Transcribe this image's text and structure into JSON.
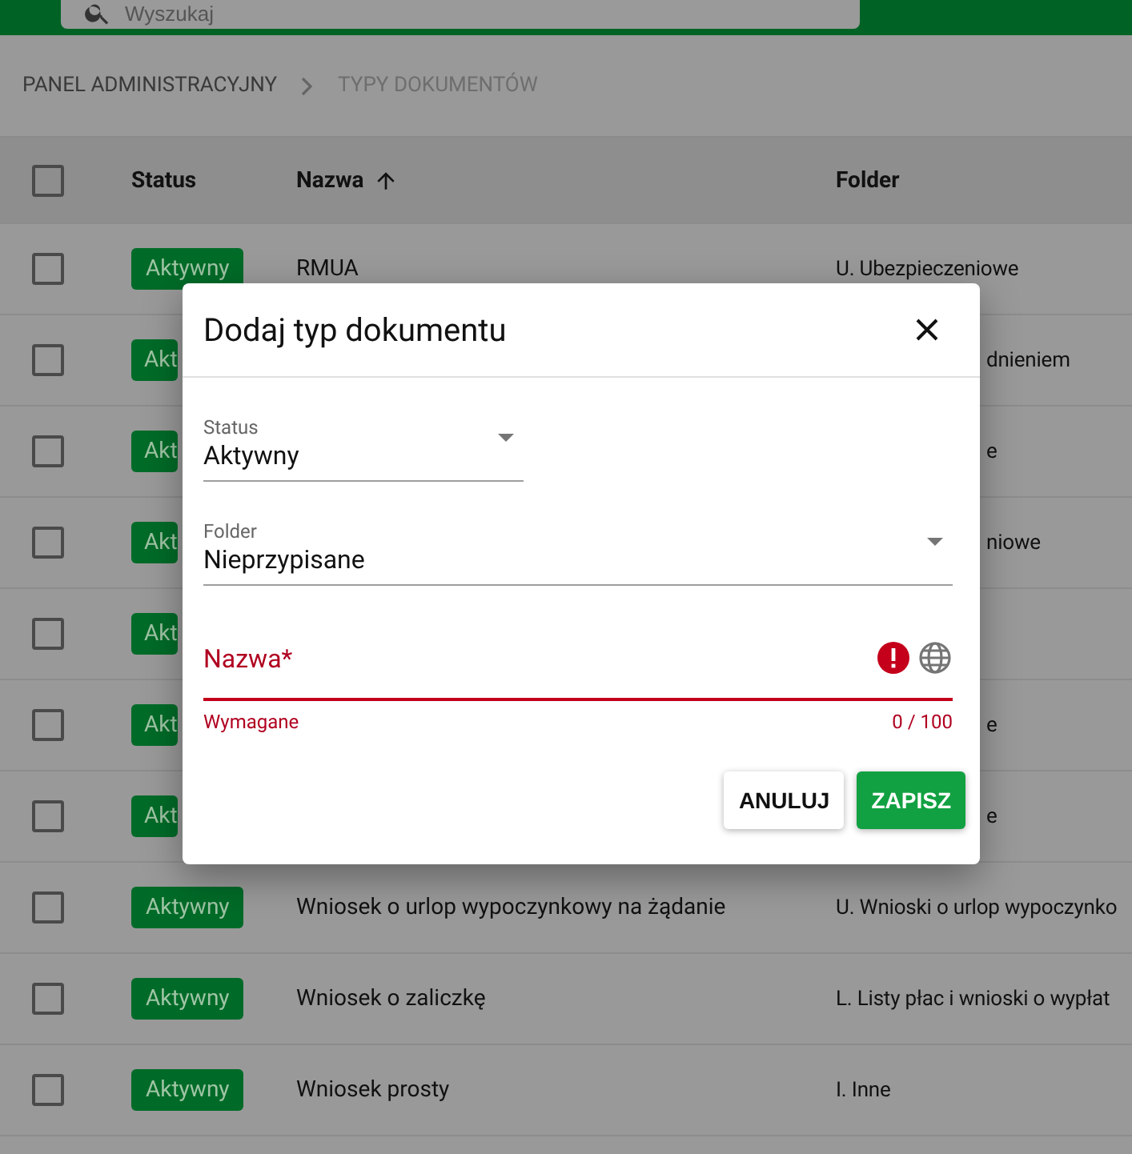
{
  "header": {
    "search": {
      "placeholder": "Wyszukaj"
    }
  },
  "breadcrumb": [
    {
      "label": "PANEL ADMINISTRACYJNY",
      "current": false
    },
    {
      "label": "TYPY DOKUMENTÓW",
      "current": true
    }
  ],
  "table": {
    "select_all": {
      "checked": false
    },
    "columns": [
      {
        "label": "Status"
      },
      {
        "label": "Nazwa",
        "sorted_ascending": true
      },
      {
        "label": "Folder"
      }
    ],
    "rows": [
      {
        "kind": "full",
        "checked": false,
        "status": "Aktywny",
        "name": "RMUA",
        "folder": "U. Ubezpieczeniowe"
      },
      {
        "kind": "partial",
        "checked": false,
        "status": "Akt",
        "folder": "dnieniem"
      },
      {
        "kind": "partial",
        "checked": false,
        "status": "Akt",
        "folder": "e"
      },
      {
        "kind": "partial",
        "checked": false,
        "status": "Akt",
        "folder": "niowe"
      },
      {
        "kind": "partial",
        "checked": false,
        "status": "Akt"
      },
      {
        "kind": "partial",
        "checked": false,
        "status": "Akt",
        "folder": "e"
      },
      {
        "kind": "partial",
        "checked": false,
        "status": "Akt",
        "folder": "e"
      },
      {
        "kind": "full",
        "checked": false,
        "status": "Aktywny",
        "name": "Wniosek o urlop wypoczynkowy na żądanie",
        "folder": "U. Wnioski o urlop wypoczynko"
      },
      {
        "kind": "full",
        "checked": false,
        "status": "Aktywny",
        "name": "Wniosek o zaliczkę",
        "folder": "L. Listy płac i wnioski o wypłat"
      },
      {
        "kind": "full",
        "checked": false,
        "status": "Aktywny",
        "name": "Wniosek prosty",
        "folder": "I. Inne"
      }
    ]
  },
  "dialog": {
    "title": "Dodaj typ dokumentu",
    "fields": [
      {
        "kind": "select",
        "label": "Status",
        "value": "Aktywny"
      },
      {
        "kind": "select",
        "label": "Folder",
        "value": "Nieprzypisane"
      },
      {
        "kind": "text",
        "label": "Nazwa*",
        "error": true,
        "helper": "Wymagane",
        "counter": "0 / 100"
      }
    ],
    "buttons": [
      {
        "label": "ANULUJ",
        "primary": false
      },
      {
        "label": "ZAPISZ",
        "primary": true
      }
    ]
  }
}
